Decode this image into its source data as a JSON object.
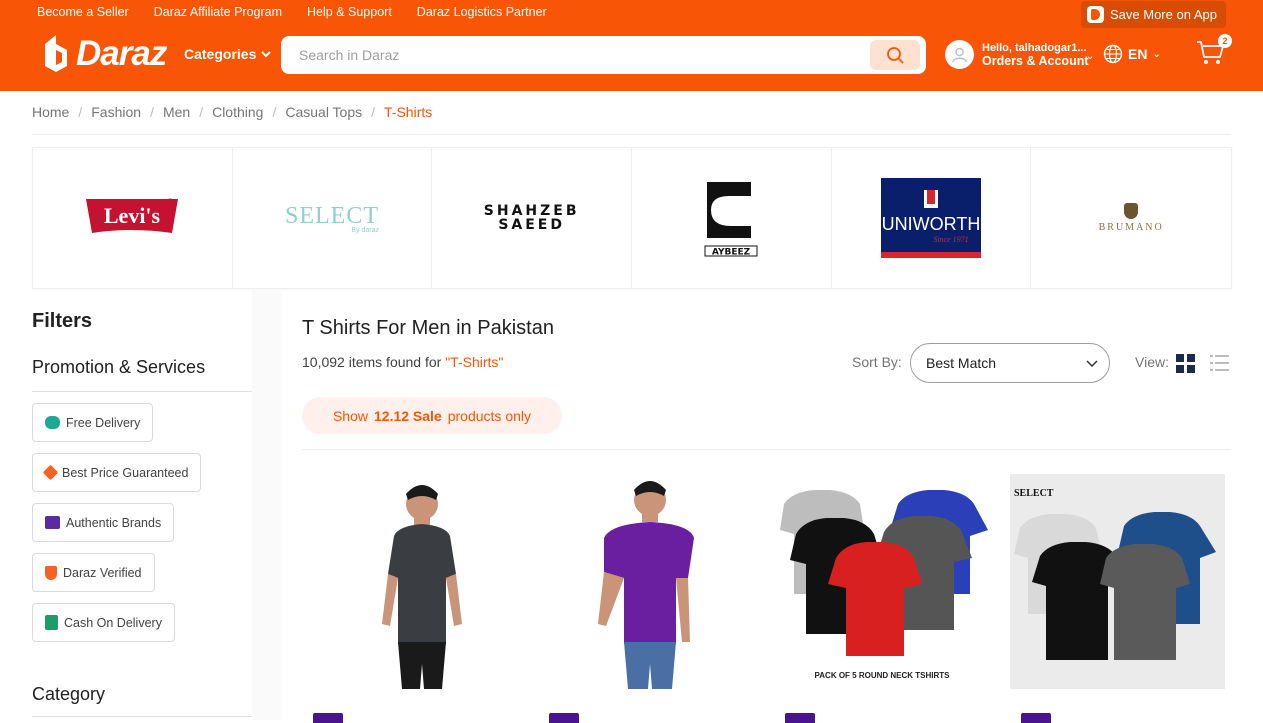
{
  "topbar": {
    "links": [
      "Become a Seller",
      "Daraz Affiliate Program",
      "Help & Support",
      "Daraz Logistics Partner"
    ],
    "app_button": "Save More on App"
  },
  "header": {
    "logo": "Daraz",
    "categories_label": "Categories",
    "search_placeholder": "Search in Daraz",
    "greeting": "Hello, talhadogar1...",
    "account_label": "Orders & Account",
    "language": "EN",
    "cart_count": "2"
  },
  "breadcrumb": [
    "Home",
    "Fashion",
    "Men",
    "Clothing",
    "Casual Tops",
    "T-Shirts"
  ],
  "brands": [
    "Levi's",
    "SELECT",
    "SHAHZEB SAEED",
    "AYBEEZ",
    "UNIWORTH",
    "BRUMANO"
  ],
  "filters": {
    "title": "Filters",
    "promotion_title": "Promotion & Services",
    "chips": [
      "Free Delivery",
      "Best Price Guaranteed",
      "Authentic Brands",
      "Daraz Verified",
      "Cash On Delivery"
    ],
    "category_title": "Category"
  },
  "results": {
    "title": "T Shirts For Men in Pakistan",
    "count_text": "10,092 items found for ",
    "query": "\"T-Shirts\"",
    "sort_label": "Sort By:",
    "sort_value": "Best Match",
    "view_label": "View:",
    "sale_prefix": "Show",
    "sale_bold": "12.12 Sale",
    "sale_suffix": "products only"
  },
  "products": [
    {
      "caption": ""
    },
    {
      "caption": ""
    },
    {
      "caption": "PACK OF 5 ROUND NECK TSHIRTS"
    },
    {
      "caption": "SELECT"
    }
  ],
  "colors": {
    "brand": "#f85606"
  }
}
